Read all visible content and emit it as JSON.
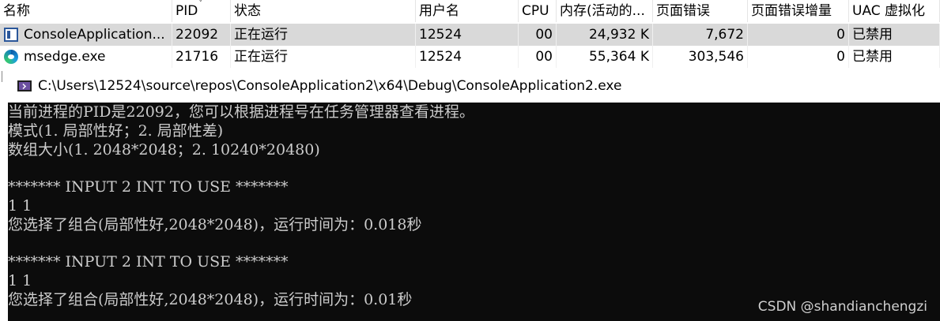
{
  "task_manager": {
    "columns": {
      "name": "名称",
      "pid": "PID",
      "status": "状态",
      "user": "用户名",
      "cpu": "CPU",
      "memory": "内存(活动的...",
      "page_faults": "页面错误",
      "page_faults_delta": "页面错误增量",
      "uac": "UAC 虚拟化"
    },
    "sort_indicator": "˅",
    "rows": [
      {
        "icon": "console-app-icon",
        "name": "ConsoleApplication...",
        "pid": "22092",
        "status": "正在运行",
        "user": "12524",
        "cpu": "00",
        "memory": "24,932 K",
        "page_faults": "7,672",
        "page_faults_delta": "0",
        "uac": "已禁用",
        "selected": true
      },
      {
        "icon": "edge-icon",
        "name": "msedge.exe",
        "pid": "21716",
        "status": "正在运行",
        "user": "12524",
        "cpu": "00",
        "memory": "55,364 K",
        "page_faults": "303,546",
        "page_faults_delta": "0",
        "uac": "已禁用",
        "selected": false
      }
    ]
  },
  "console": {
    "title": "C:\\Users\\12524\\source\\repos\\ConsoleApplication2\\x64\\Debug\\ConsoleApplication2.exe",
    "lines": [
      "当前进程的PID是22092，您可以根据进程号在任务管理器查看进程。",
      "模式(1. 局部性好；2. 局部性差)",
      "数组大小(1. 2048*2048；2. 10240*20480)",
      "",
      "******* INPUT 2 INT TO USE *******",
      "1 1",
      "您选择了组合(局部性好,2048*2048)，运行时间为：0.018秒",
      "",
      "******* INPUT 2 INT TO USE *******",
      "1 1",
      "您选择了组合(局部性好,2048*2048)，运行时间为：0.01秒"
    ]
  },
  "watermark": "CSDN @shandianchengzi",
  "colors": {
    "console_bg": "#0c0c0c",
    "console_text": "#cccccc",
    "selected_row": "#d9d9d9"
  }
}
